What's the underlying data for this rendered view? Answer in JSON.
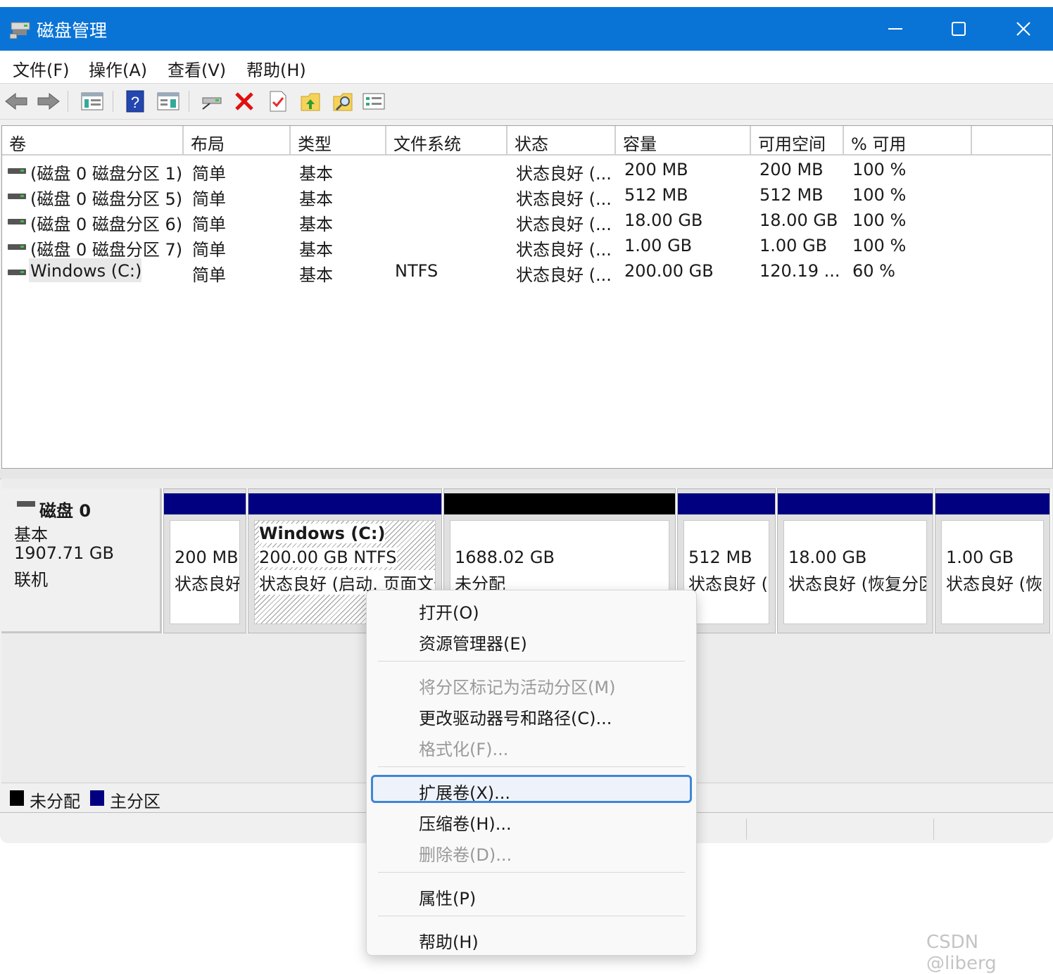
{
  "window": {
    "title": "磁盘管理",
    "controls": [
      "minimize-icon",
      "maximize-icon",
      "close-icon"
    ],
    "accent": "#0a74d6"
  },
  "menu": [
    "文件(F)",
    "操作(A)",
    "查看(V)",
    "帮助(H)"
  ],
  "toolbar": {
    "icons": [
      "back-arrow-icon",
      "forward-arrow-icon",
      "console-tree-icon",
      "help-icon",
      "properties-pane-icon",
      "connect-drive-icon",
      "delete-icon",
      "checklist-icon",
      "folder-up-icon",
      "folder-search-icon",
      "settings-list-icon"
    ]
  },
  "volume_list": {
    "columns": [
      "卷",
      "布局",
      "类型",
      "文件系统",
      "状态",
      "容量",
      "可用空间",
      "% 可用"
    ],
    "rows": [
      {
        "volume": "(磁盘 0 磁盘分区 1)",
        "layout": "简单",
        "type": "基本",
        "fs": "",
        "status": "状态良好 (...",
        "capacity": "200 MB",
        "free": "200 MB",
        "pct": "100 %"
      },
      {
        "volume": "(磁盘 0 磁盘分区 5)",
        "layout": "简单",
        "type": "基本",
        "fs": "",
        "status": "状态良好 (...",
        "capacity": "512 MB",
        "free": "512 MB",
        "pct": "100 %"
      },
      {
        "volume": "(磁盘 0 磁盘分区 6)",
        "layout": "简单",
        "type": "基本",
        "fs": "",
        "status": "状态良好 (...",
        "capacity": "18.00 GB",
        "free": "18.00 GB",
        "pct": "100 %"
      },
      {
        "volume": "(磁盘 0 磁盘分区 7)",
        "layout": "简单",
        "type": "基本",
        "fs": "",
        "status": "状态良好 (...",
        "capacity": "1.00 GB",
        "free": "1.00 GB",
        "pct": "100 %"
      },
      {
        "volume": "Windows (C:)",
        "layout": "简单",
        "type": "基本",
        "fs": "NTFS",
        "status": "状态良好 (...",
        "capacity": "200.00 GB",
        "free": "120.19 ...",
        "pct": "60 %"
      }
    ]
  },
  "disk": {
    "name": "磁盘 0",
    "type": "基本",
    "size": "1907.71 GB",
    "state": "联机",
    "partitions": [
      {
        "title": "",
        "size": "200 MB",
        "status": "状态良好",
        "kind": "primary"
      },
      {
        "title": "Windows  (C:)",
        "size": "200.00 GB NTFS",
        "status": "状态良好 (启动, 页面文件",
        "kind": "primary-selected"
      },
      {
        "title": "",
        "size": "1688.02 GB",
        "status": "未分配",
        "kind": "unallocated"
      },
      {
        "title": "",
        "size": "512 MB",
        "status": "状态良好 (",
        "kind": "primary"
      },
      {
        "title": "",
        "size": "18.00 GB",
        "status": "状态良好 (恢复分区",
        "kind": "primary"
      },
      {
        "title": "",
        "size": "1.00 GB",
        "status": "状态良好 (恢",
        "kind": "primary"
      }
    ]
  },
  "legend": [
    {
      "label": "未分配",
      "color": "#000000"
    },
    {
      "label": "主分区",
      "color": "#000080"
    }
  ],
  "context_menu": {
    "items": [
      {
        "label": "打开(O)",
        "enabled": true
      },
      {
        "label": "资源管理器(E)",
        "enabled": true
      },
      {
        "label": "将分区标记为活动分区(M)",
        "enabled": false
      },
      {
        "label": "更改驱动器号和路径(C)...",
        "enabled": true
      },
      {
        "label": "格式化(F)...",
        "enabled": false
      },
      {
        "label": "扩展卷(X)...",
        "enabled": true,
        "focused": true
      },
      {
        "label": "压缩卷(H)...",
        "enabled": true
      },
      {
        "label": "删除卷(D)...",
        "enabled": false
      },
      {
        "label": "属性(P)",
        "enabled": true
      },
      {
        "label": "帮助(H)",
        "enabled": true
      }
    ]
  },
  "watermark": "CSDN @liberg"
}
